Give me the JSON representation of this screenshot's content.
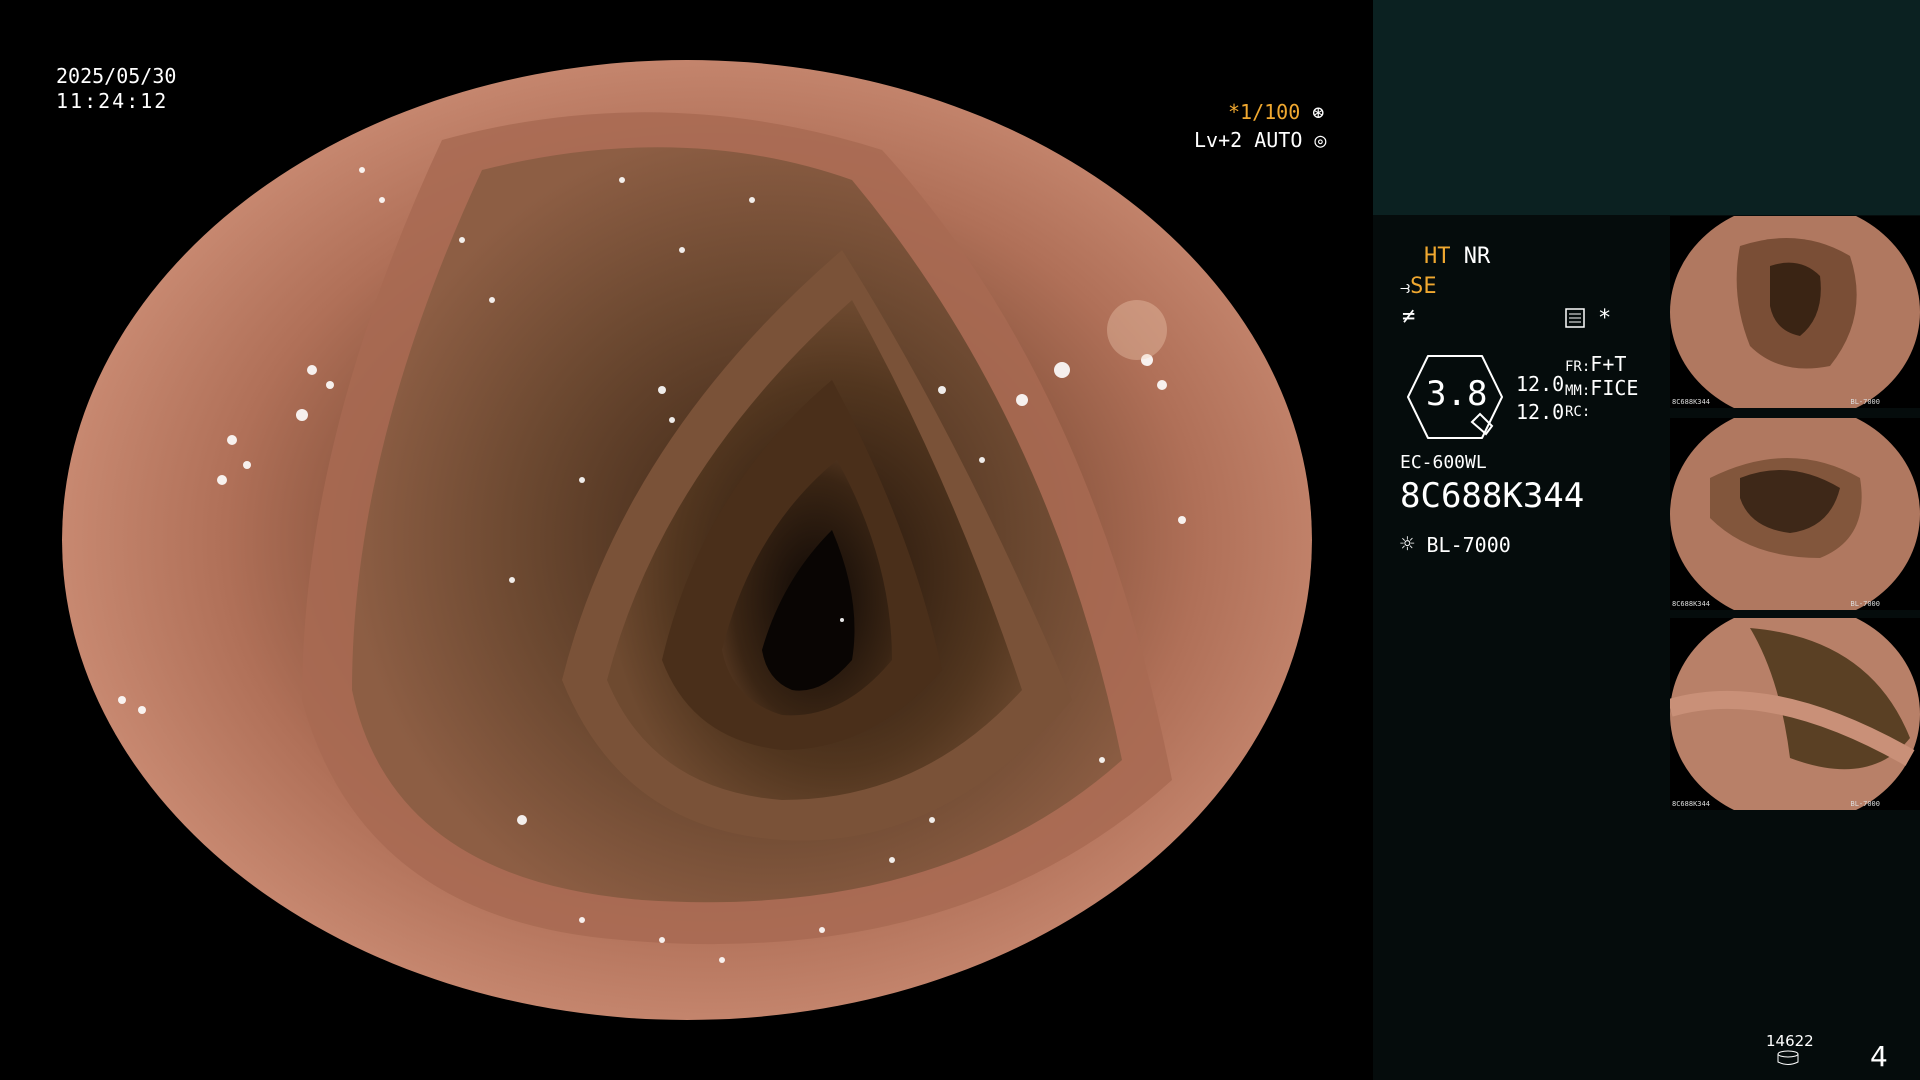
{
  "osd": {
    "date": "2025/05/30",
    "time": "11:24:12",
    "shutter": "*1/100",
    "level": "Lv+2 AUTO"
  },
  "panel": {
    "ht": "HT",
    "nr": "NR",
    "se": "SE",
    "asterisk": "*",
    "dial_value": "3.8",
    "val1": "12.0",
    "val2": "12.0",
    "fr_label": "FR:",
    "fr_value": "F+T",
    "mm_label": "MM:",
    "mm_value": "FICE",
    "rc_label": "RC:",
    "scope_model": "EC-600WL",
    "serial": "8C688K344",
    "light_source": "BL-7000",
    "counter": "14622",
    "page_number": "4"
  },
  "thumbnails": [
    {
      "serial": "8C688K344",
      "light": "BL-7000"
    },
    {
      "serial": "8C688K344",
      "light": "BL-7000"
    },
    {
      "serial": "8C688K344",
      "light": "BL-7000"
    }
  ],
  "colors": {
    "accent_orange": "#f0a830",
    "panel_bg": "#050c0c",
    "panel_top_band": "#0b2121"
  }
}
